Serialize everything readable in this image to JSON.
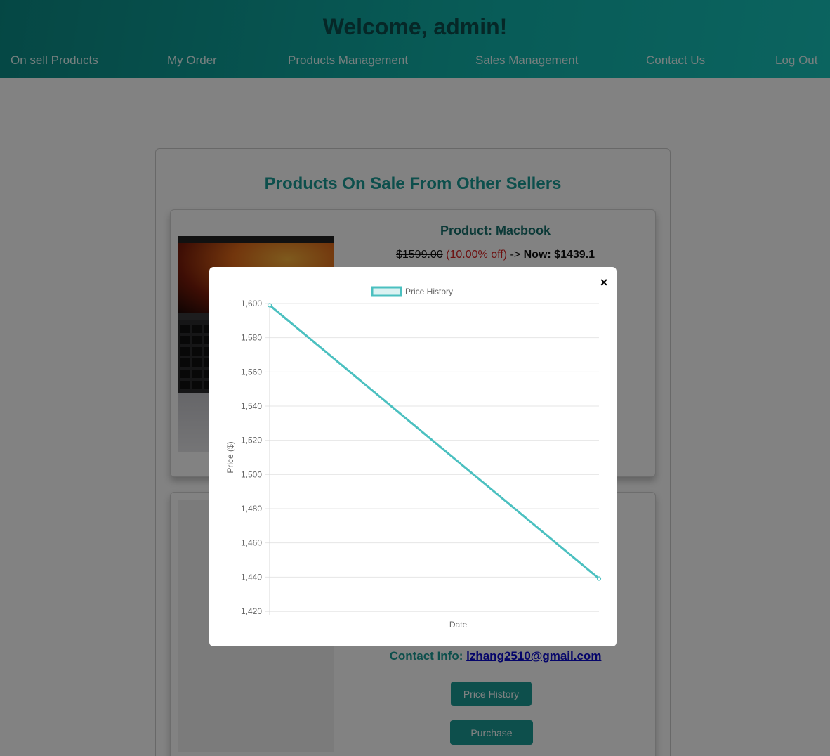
{
  "header": {
    "welcome": "Welcome, admin!",
    "nav": [
      {
        "label": "On sell Products",
        "name": "nav-on-sell-products"
      },
      {
        "label": "My Order",
        "name": "nav-my-order"
      },
      {
        "label": "Products Management",
        "name": "nav-products-management"
      },
      {
        "label": "Sales Management",
        "name": "nav-sales-management"
      },
      {
        "label": "Contact Us",
        "name": "nav-contact-us"
      },
      {
        "label": "Log Out",
        "name": "nav-log-out"
      }
    ]
  },
  "main": {
    "title": "Products On Sale From Other Sellers",
    "products": [
      {
        "name": "Product: Macbook",
        "old_price": "$1599.00",
        "discount": "(10.00% off)",
        "arrow": "->",
        "now_price": "Now: $1439.1"
      },
      {
        "contact_label": "Contact Info:",
        "contact_email": "lzhang2510@gmail.com",
        "price_history_button": "Price History",
        "purchase_button": "Purchase"
      }
    ]
  },
  "modal": {
    "close_symbol": "×"
  },
  "chart_data": {
    "type": "line",
    "series": [
      {
        "name": "Price History",
        "color": "#4bc0c0",
        "values": [
          1599,
          1439.1
        ]
      }
    ],
    "x": [
      "",
      ""
    ],
    "xlabel": "Date",
    "ylabel": "Price ($)",
    "ylim": [
      1420,
      1600
    ],
    "yticks": [
      1600,
      1580,
      1560,
      1540,
      1520,
      1500,
      1480,
      1460,
      1440,
      1420
    ],
    "ytick_labels": [
      "1,600",
      "1,580",
      "1,560",
      "1,540",
      "1,520",
      "1,500",
      "1,480",
      "1,460",
      "1,440",
      "1,420"
    ],
    "grid": true,
    "legend": "top-center"
  }
}
